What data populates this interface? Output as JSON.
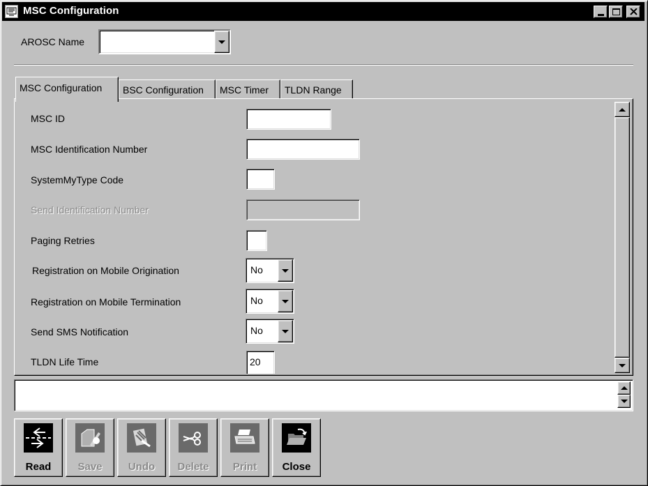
{
  "window": {
    "title": "MSC Configuration"
  },
  "arosc": {
    "label": "AROSC Name",
    "value": ""
  },
  "tabs": [
    {
      "label": "MSC Configuration",
      "active": true
    },
    {
      "label": "BSC Configuration",
      "active": false
    },
    {
      "label": "MSC Timer",
      "active": false
    },
    {
      "label": "TLDN Range",
      "active": false
    }
  ],
  "form": {
    "msc_id": {
      "label": "MSC ID",
      "value": ""
    },
    "msc_identification_number": {
      "label": "MSC Identification Number",
      "value": ""
    },
    "system_my_type_code": {
      "label": "SystemMyType Code",
      "value": ""
    },
    "send_identification_number": {
      "label": "Send Identification Number",
      "value": "",
      "disabled": true
    },
    "paging_retries": {
      "label": "Paging Retries",
      "value": ""
    },
    "registration_origination": {
      "label": "Registration on Mobile Origination",
      "value": "No"
    },
    "registration_termination": {
      "label": "Registration on Mobile Termination",
      "value": "No"
    },
    "send_sms_notification": {
      "label": "Send SMS Notification",
      "value": "No"
    },
    "tldn_life_time": {
      "label": "TLDN Life Time",
      "value": "20"
    }
  },
  "message_area": {
    "value": ""
  },
  "toolbar": {
    "read": {
      "label": "Read",
      "enabled": true
    },
    "save": {
      "label": "Save",
      "enabled": false
    },
    "undo": {
      "label": "Undo",
      "enabled": false
    },
    "delete": {
      "label": "Delete",
      "enabled": false
    },
    "print": {
      "label": "Print",
      "enabled": false
    },
    "close": {
      "label": "Close",
      "enabled": true
    }
  }
}
